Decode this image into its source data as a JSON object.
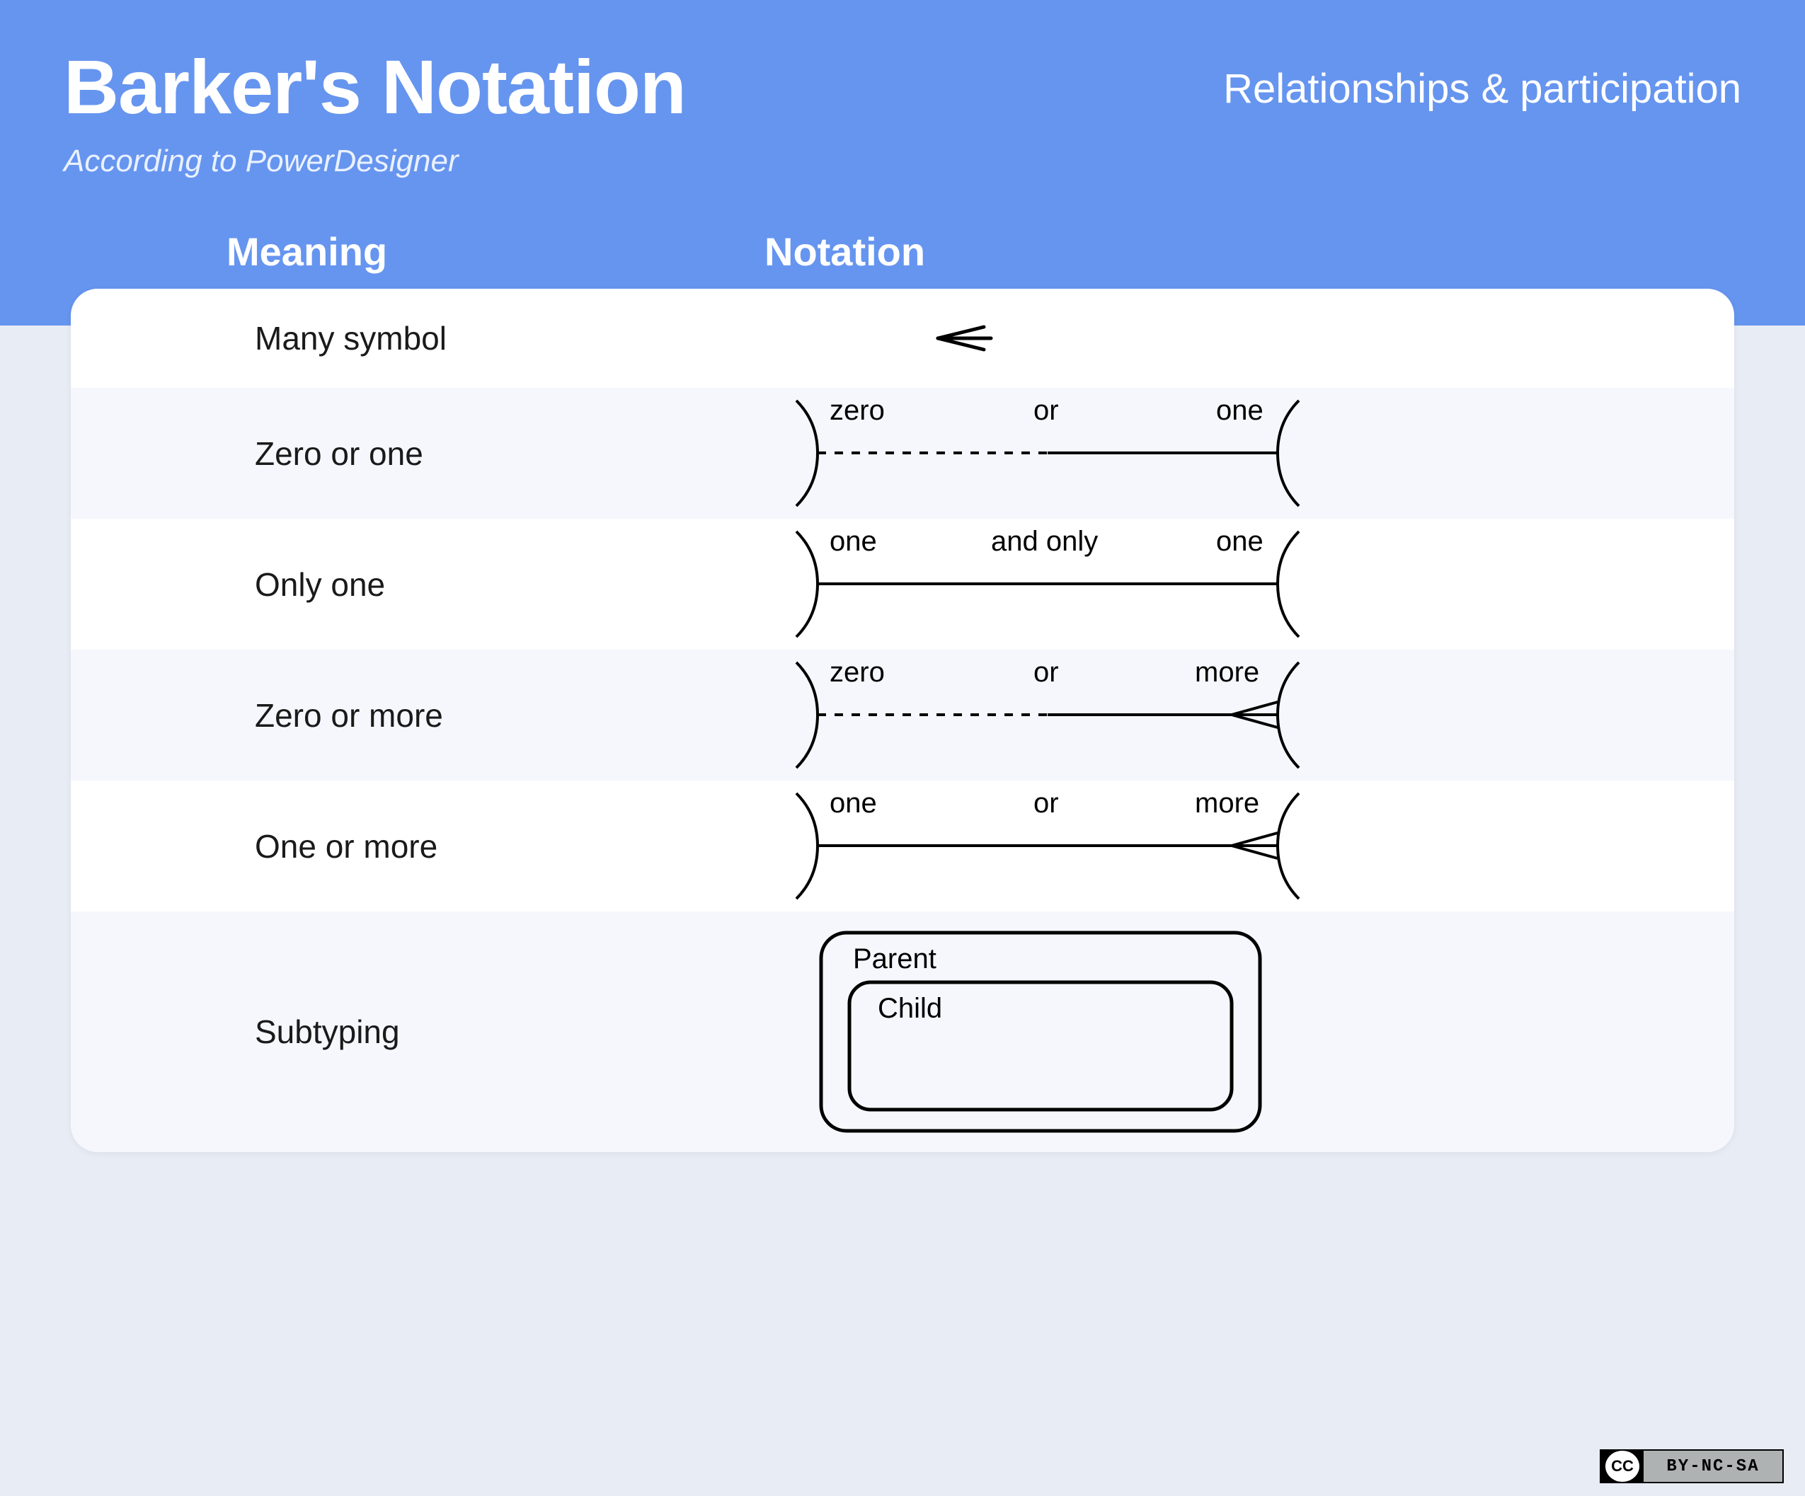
{
  "header": {
    "title": "Barker's Notation",
    "subtitle": "According to PowerDesigner",
    "section": "Relationships & participation"
  },
  "columns": {
    "meaning": "Meaning",
    "notation": "Notation"
  },
  "rows": {
    "many": {
      "meaning": "Many symbol"
    },
    "zero_or_one": {
      "meaning": "Zero or one",
      "labels": {
        "l1": "zero",
        "l2": "or",
        "l3": "one"
      }
    },
    "only_one": {
      "meaning": "Only one",
      "labels": {
        "l1": "one",
        "l2": "and only",
        "l3": "one"
      }
    },
    "zero_or_more": {
      "meaning": "Zero or more",
      "labels": {
        "l1": "zero",
        "l2": "or",
        "l3": "more"
      }
    },
    "one_or_more": {
      "meaning": "One or more",
      "labels": {
        "l1": "one",
        "l2": "or",
        "l3": "more"
      }
    },
    "subtyping": {
      "meaning": "Subtyping",
      "parent": "Parent",
      "child": "Child"
    }
  },
  "license": {
    "cc": "CC",
    "text": "BY-NC-SA"
  },
  "colors": {
    "header_bg": "#6695ef",
    "page_bg": "#e8ecf4",
    "row_alt": "#f5f7fd",
    "stroke": "#000000"
  }
}
